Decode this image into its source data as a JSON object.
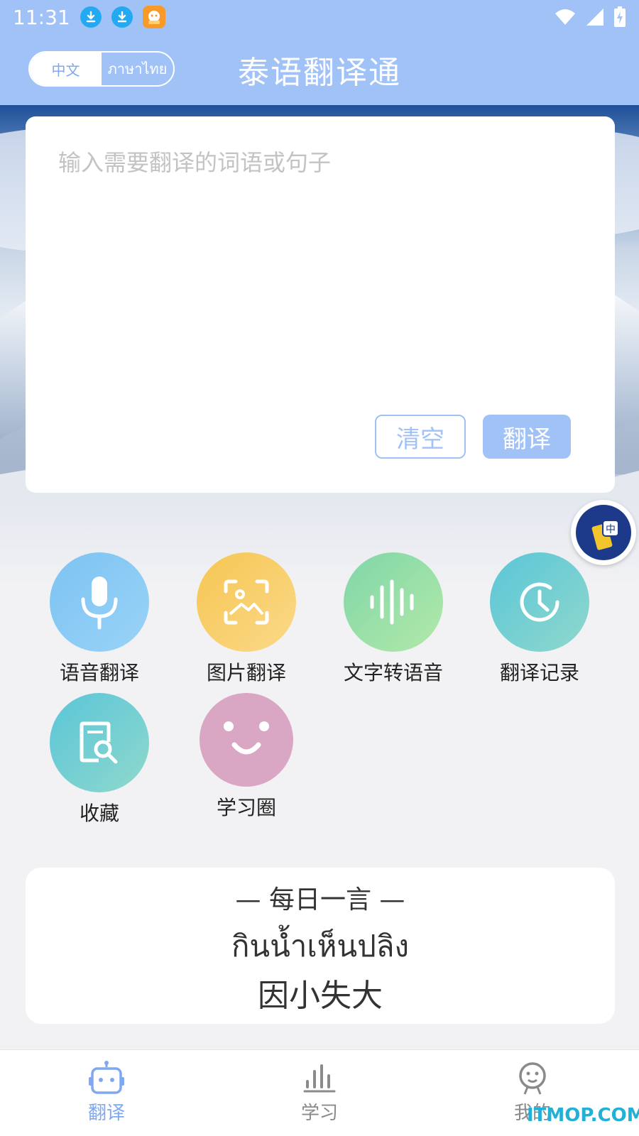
{
  "status_bar": {
    "time": "11:31",
    "icons": [
      "download-icon",
      "download-icon",
      "app-notification-icon",
      "wifi-icon",
      "signal-icon",
      "battery-charging-icon"
    ]
  },
  "header": {
    "title": "泰语翻译通",
    "lang_switch": {
      "chinese": "中文",
      "thai": "ภาษาไทย",
      "active": "chinese"
    }
  },
  "input": {
    "placeholder": "输入需要翻译的词语或句子",
    "clear_label": "清空",
    "translate_label": "翻译"
  },
  "features": [
    {
      "label": "语音翻译",
      "icon": "microphone-icon",
      "color_from": "#7cc3f3",
      "color_to": "#9ad3f7"
    },
    {
      "label": "图片翻译",
      "icon": "image-scan-icon",
      "color_from": "#f6c652",
      "color_to": "#fbd98a"
    },
    {
      "label": "文字转语音",
      "icon": "sound-wave-icon",
      "color_from": "#7fd6a8",
      "color_to": "#b3e9a9"
    },
    {
      "label": "翻译记录",
      "icon": "clock-icon",
      "color_from": "#5ac6d8",
      "color_to": "#8fd8cc"
    },
    {
      "label": "收藏",
      "icon": "document-search-icon",
      "color_from": "#5ac6d8",
      "color_to": "#8fd8cc"
    },
    {
      "label": "学习圈",
      "icon": "smiley-face-icon",
      "color_from": "#d9a7c4",
      "color_to": "#d9a7c4"
    }
  ],
  "daily_quote": {
    "heading": "—  每日一言  —",
    "thai": "กินน้ำเห็นปลิง",
    "chinese": "因小失大"
  },
  "bottom_nav": [
    {
      "label": "翻译",
      "icon": "robot-icon",
      "active": true
    },
    {
      "label": "学习",
      "icon": "bar-chart-icon",
      "active": false
    },
    {
      "label": "我的",
      "icon": "profile-face-icon",
      "active": false
    }
  ],
  "watermark": "ITMOP.COM",
  "colors": {
    "primary": "#a1c2f7",
    "primary_text": "#7fa8f0",
    "background": "#f2f2f4"
  }
}
